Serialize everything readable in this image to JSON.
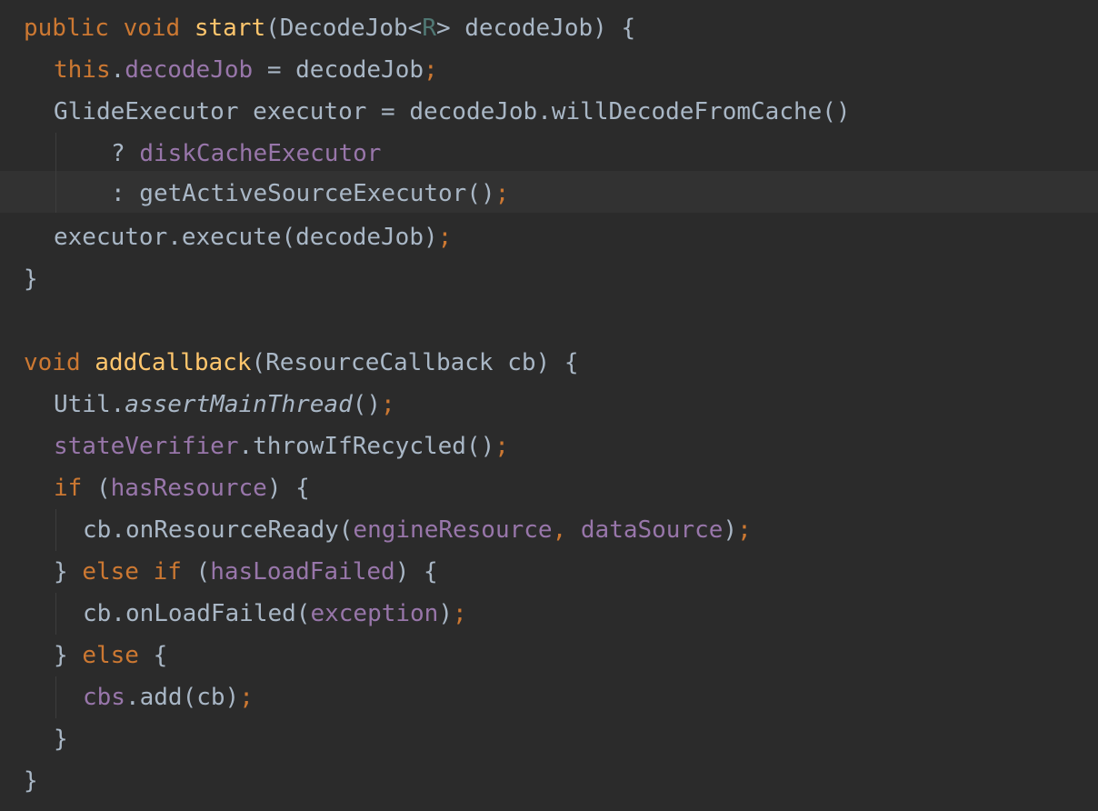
{
  "editor": {
    "theme": "Darcula",
    "colors": {
      "background": "#2b2b2b",
      "current_line": "#323232",
      "default_text": "#a9b7c6",
      "keyword": "#cc7832",
      "method_declaration": "#ffc66d",
      "field": "#9876aa",
      "type_parameter": "#507874"
    },
    "current_line_index": 4,
    "lines": [
      [
        "public void ",
        "start",
        "(DecodeJob<",
        "R",
        "> decodeJob) {"
      ],
      [
        "this",
        ".",
        "decodeJob",
        " = decodeJob",
        ";"
      ],
      [
        "GlideExecutor executor = decodeJob.willDecodeFromCache()"
      ],
      [
        "? ",
        "diskCacheExecutor"
      ],
      [
        ": getActiveSourceExecutor()",
        ";"
      ],
      [
        "executor.execute(decodeJob)",
        ";"
      ],
      [
        "}"
      ],
      [
        ""
      ],
      [
        "void ",
        "addCallback",
        "(ResourceCallback cb) {"
      ],
      [
        "Util.",
        "assertMainThread",
        "()",
        ";"
      ],
      [
        "stateVerifier",
        ".throwIfRecycled()",
        ";"
      ],
      [
        "if ",
        "(",
        "hasResource",
        ") {"
      ],
      [
        "cb.onResourceReady(",
        "engineResource",
        ", ",
        "dataSource",
        ")",
        ";"
      ],
      [
        "} ",
        "else if ",
        "(",
        "hasLoadFailed",
        ") {"
      ],
      [
        "cb.onLoadFailed(",
        "exception",
        ")",
        ";"
      ],
      [
        "} ",
        "else ",
        "{"
      ],
      [
        "cbs",
        ".add(cb)",
        ";"
      ],
      [
        "}"
      ],
      [
        "}"
      ]
    ]
  }
}
